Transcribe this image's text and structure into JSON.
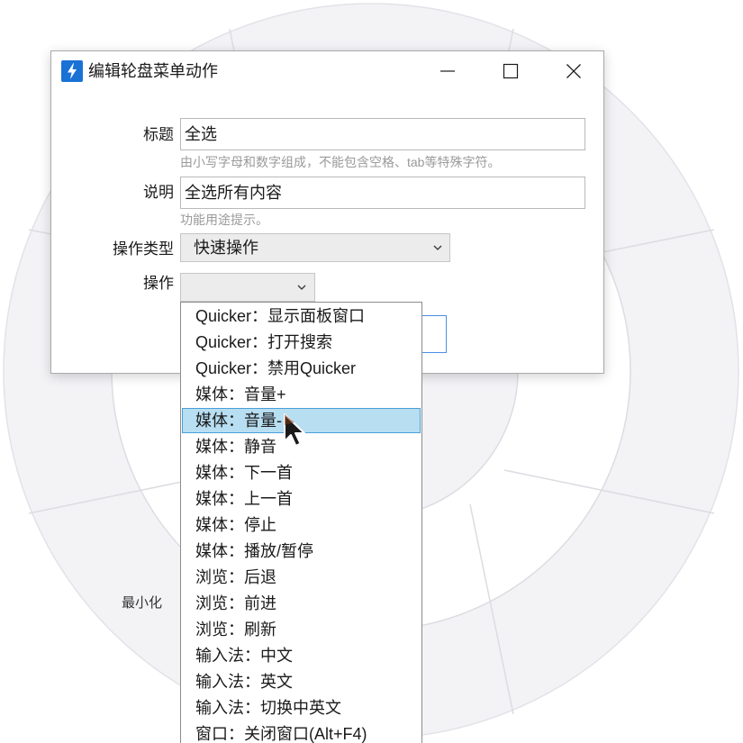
{
  "window": {
    "title": "编辑轮盘菜单动作",
    "app_icon": "lightning-bolt-icon",
    "controls": [
      "minimize-icon",
      "maximize-icon",
      "close-icon"
    ]
  },
  "form": {
    "title_label": "标题",
    "title_value": "全选",
    "title_hint": "由小写字母和数字组成，不能包含空格、tab等特殊字符。",
    "desc_label": "说明",
    "desc_value": "全选所有内容",
    "desc_hint": "功能用途提示。",
    "type_label": "操作类型",
    "type_value": "快速操作",
    "action_label": "操作",
    "action_value": ""
  },
  "dropdown": {
    "items": [
      "Quicker：显示面板窗口",
      "Quicker：打开搜索",
      "Quicker：禁用Quicker",
      "媒体：音量+",
      "媒体：音量-",
      "媒体：静音",
      "媒体：下一首",
      "媒体：上一首",
      "媒体：停止",
      "媒体：播放/暂停",
      "浏览：后退",
      "浏览：前进",
      "浏览：刷新",
      "输入法：中文",
      "输入法：英文",
      "输入法：切换中英文",
      "窗口：关闭窗口(Alt+F4)"
    ],
    "selected_index": 4
  },
  "wheel": {
    "segment_label": "最小化"
  },
  "colors": {
    "accent": "#1a72d6",
    "selection_bg": "#b8def2",
    "selection_border": "#4a9fd8",
    "wheel_fill": "#f3f3f6",
    "wheel_line": "#dcdce2"
  }
}
